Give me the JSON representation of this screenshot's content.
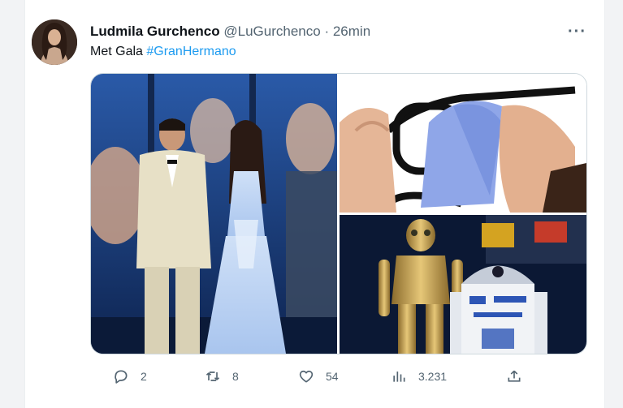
{
  "tweet": {
    "author": {
      "display_name": "Ludmila Gurchenco",
      "handle": "@LuGurchenco",
      "separator": "·",
      "time": "26min"
    },
    "more_icon": "more-horizontal-icon",
    "text": {
      "plain": "Met Gala ",
      "hashtag": "#GranHermano"
    },
    "media": [
      {
        "name": "couple-photo",
        "description_icon": "photo"
      },
      {
        "name": "glasses-cleaning-photo",
        "description_icon": "photo"
      },
      {
        "name": "robots-photo",
        "description_icon": "photo"
      }
    ],
    "actions": {
      "reply_count": "2",
      "retweet_count": "8",
      "like_count": "54",
      "views_count": "3.231"
    },
    "colors": {
      "link": "#1d9bf0",
      "secondary_text": "#536471",
      "primary_text": "#0f1419"
    }
  }
}
